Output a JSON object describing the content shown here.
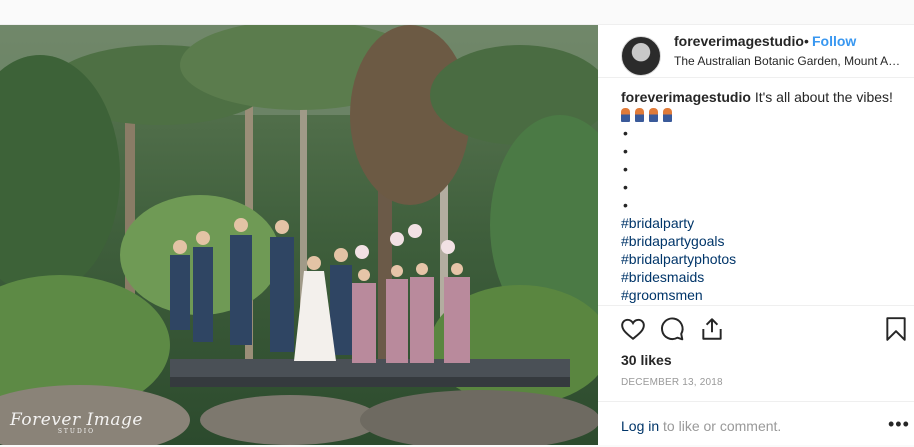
{
  "post": {
    "username": "foreverimagestudio",
    "separator": "•",
    "follow_label": "Follow",
    "location": "The Australian Botanic Garden, Mount Annan"
  },
  "photo": {
    "watermark": "Forever Image",
    "watermark_sub": "STUDIO"
  },
  "caption": {
    "username": "foreverimagestudio",
    "text": "It's all about the vibes!",
    "emoji_colors": [
      "#e07b39",
      "#e07b39",
      "#e07b39",
      "#e07b39"
    ],
    "dots": [
      "•",
      "•",
      "•",
      "•",
      "•"
    ],
    "hashtags": [
      "#bridalparty",
      "#bridapartygoals",
      "#bridalpartyphotos",
      "#bridesmaids",
      "#groomsmen"
    ]
  },
  "actions": {
    "icons": [
      "heart-icon",
      "comment-icon",
      "share-icon",
      "bookmark-icon"
    ],
    "likes": "30 likes",
    "date": "DECEMBER 13, 2018"
  },
  "footer": {
    "login_link": "Log in",
    "login_text": " to like or comment.",
    "more": "•••"
  },
  "colors": {
    "link_blue": "#3897f0",
    "hashtag_navy": "#003569",
    "muted": "#999999"
  }
}
